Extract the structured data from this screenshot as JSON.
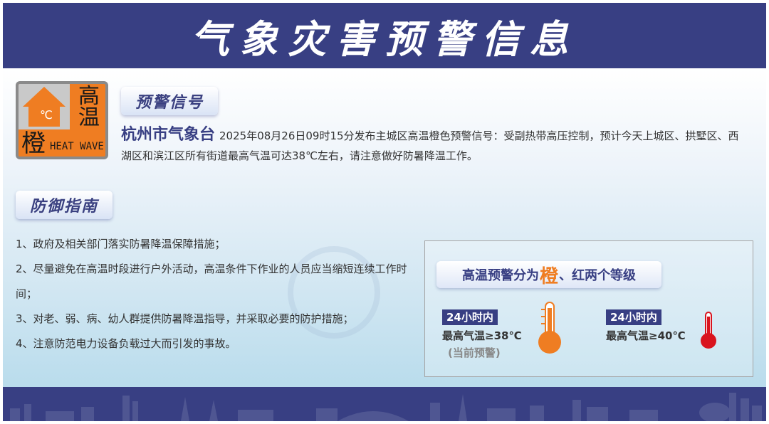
{
  "banner": {
    "title": "气象灾害预警信息"
  },
  "badge": {
    "unit": "℃",
    "line1": "高",
    "line2": "温",
    "level": "橙",
    "english": "HEAT WAVE",
    "color": "#ef7d22"
  },
  "signal": {
    "heading": "预警信号",
    "bureau": "杭州市气象台",
    "text": "2025年08月26日09时15分发布主城区高温橙色预警信号：受副热带高压控制，预计今天上城区、拱墅区、西湖区和滨江区所有街道最高气温可达38℃左右，请注意做好防暑降温工作。"
  },
  "guide": {
    "heading": "防御指南",
    "items": [
      "1、政府及相关部门落实防暑降温保障措施；",
      "2、尽量避免在高温时段进行户外活动，高温条件下作业的人员应当缩短连续工作时间；",
      "3、对老、弱、病、幼人群提供防暑降温指导，并采取必要的防护措施；",
      "4、注意防范电力设备负载过大而引发的事故。"
    ]
  },
  "levels": {
    "title_prefix": "高温预警分为",
    "title_highlight": "橙",
    "title_suffix": "、红两个等级",
    "orange": {
      "tag": "24小时内",
      "condition": "最高气温≥38℃",
      "note": "(当前预警)",
      "color": "#ef7d22"
    },
    "red": {
      "tag": "24小时内",
      "condition": "最高气温≥40℃",
      "color": "#d9141e"
    }
  },
  "colors": {
    "navy": "#383f83",
    "orange": "#ef7d22",
    "red": "#d9141e"
  }
}
